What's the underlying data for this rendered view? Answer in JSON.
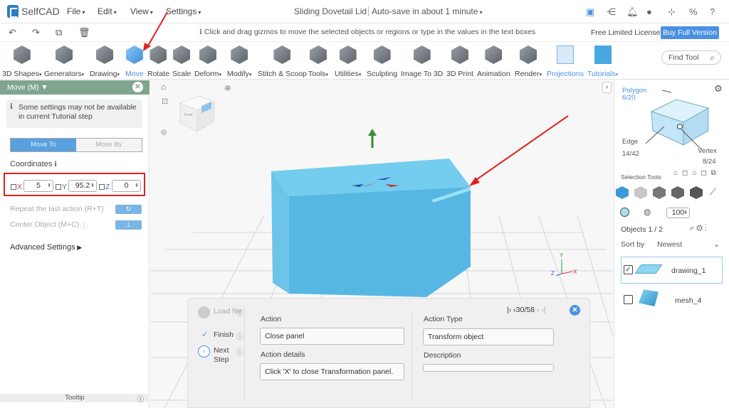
{
  "app": {
    "name": "SelfCAD",
    "document_title": "Sliding Dovetail Lid",
    "autosave": "Auto-save in about 1 minute"
  },
  "menus": [
    "File",
    "Edit",
    "View",
    "Settings"
  ],
  "hint": "Click and drag gizmos to move the selected objects or regions or type in the values in the text boxes",
  "license": {
    "label": "Free Limited License",
    "buy_label": "Buy Full Version"
  },
  "toolbar": {
    "tools": [
      "3D Shapes",
      "Generators",
      "Drawing",
      "Move",
      "Rotate",
      "Scale",
      "Deform",
      "Modify",
      "Stitch & Scoop",
      "Tools",
      "Utilities",
      "Sculpting",
      "Image To 3D",
      "3D Print",
      "Animation",
      "Render",
      "Projections",
      "Tutorials"
    ],
    "active": "Move",
    "find_placeholder": "Find Tool"
  },
  "move_panel": {
    "title": "Move (M)",
    "notice": "Some settings may not be available in current Tutorial step",
    "mode_options": [
      "Move To",
      "Move By"
    ],
    "selected_mode": "Move To",
    "coordinates_label": "Coordinates",
    "x_label": "X",
    "x_value": "5",
    "y_label": "Y",
    "y_value": "95.2",
    "z_label": "Z",
    "z_value": "0",
    "repeat_label": "Repeat the last action (R+T)",
    "center_label": "Center Object (M+C)",
    "advanced_label": "Advanced Settings",
    "tooltip_label": "Tooltip"
  },
  "view_cube": {
    "face_label": "Front"
  },
  "action_panel": {
    "steps": [
      {
        "label": "Load file"
      },
      {
        "label": "Finish"
      },
      {
        "label": "Next Step"
      }
    ],
    "nav": "30/58",
    "action_label": "Action",
    "action_value": "Close panel",
    "details_label": "Action details",
    "details_value": "Click 'X' to close Transformation panel.",
    "type_label": "Action Type",
    "type_value": "Transform object",
    "description_label": "Description",
    "description_value": ""
  },
  "selection": {
    "polygon_label": "Polygon",
    "polygon_count": "6/20",
    "edge_label": "Edge",
    "edge_count": "14/42",
    "vertex_label": "Vertex",
    "vertex_count": "8/24",
    "tools_label": "Selection Tools",
    "brush_size": "100"
  },
  "objects": {
    "header": "Objects 1 / 2",
    "sort_label": "Sort by",
    "sort_value": "Newest",
    "items": [
      {
        "name": "drawing_1",
        "checked": true
      },
      {
        "name": "mesh_4",
        "checked": false
      }
    ]
  },
  "colors": {
    "accent": "#4a90e2",
    "panel_header": "#7fa58f",
    "box": "#5bbfe6",
    "highlight": "#e02020"
  }
}
